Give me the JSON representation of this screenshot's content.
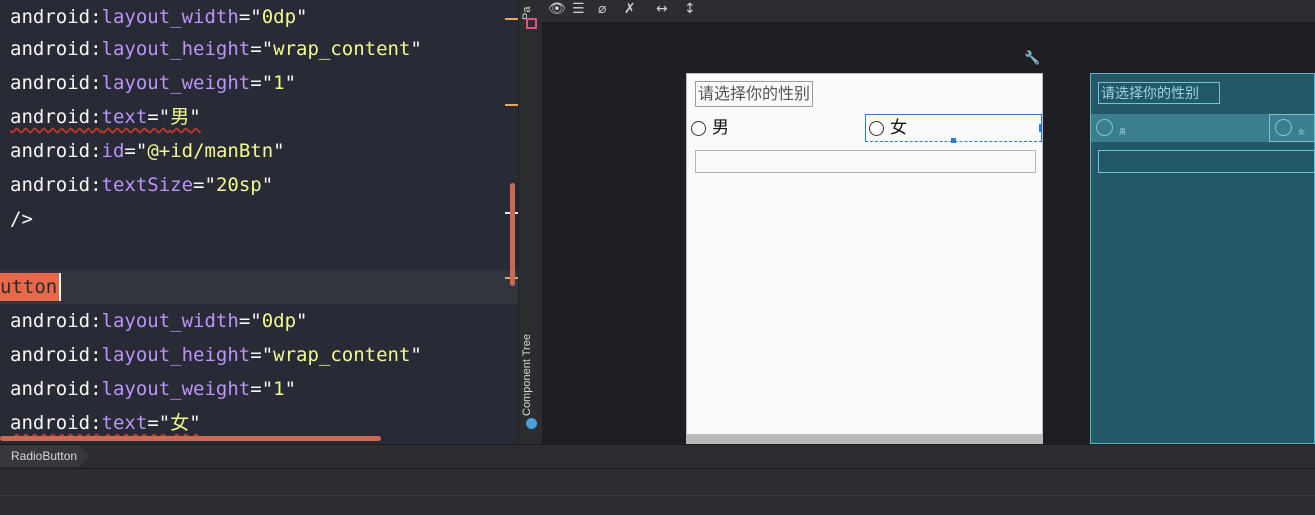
{
  "editor": {
    "lines": [
      {
        "attr": "layout_width",
        "value": "0dp"
      },
      {
        "attr": "layout_height",
        "value": "wrap_content"
      },
      {
        "attr": "layout_weight",
        "value": "1"
      },
      {
        "attr": "text",
        "value": "男"
      },
      {
        "attr": "id",
        "value": "@+id/manBtn"
      },
      {
        "attr": "textSize",
        "value": "20sp"
      }
    ],
    "close_tag": "/>",
    "selected_tag": "utton",
    "lines2": [
      {
        "attr": "layout_width",
        "value": "0dp"
      },
      {
        "attr": "layout_height",
        "value": "wrap_content"
      },
      {
        "attr": "layout_weight",
        "value": "1"
      },
      {
        "attr": "text",
        "value": "女"
      }
    ],
    "namespace": "android"
  },
  "side_panel": {
    "top_label": "Pa",
    "component_tree_label": "Component Tree"
  },
  "preview": {
    "title": "请选择你的性别",
    "radio_male": "男",
    "radio_female": "女"
  },
  "blueprint": {
    "title": "请选择你的性别",
    "radio_male": "男",
    "radio_female": "女"
  },
  "breadcrumb": {
    "item": "RadioButton"
  },
  "colors": {
    "editor_bg": "#282a36",
    "attr": "#bd93f9",
    "string": "#f1fa8c",
    "selection": "#e8694a",
    "blueprint_bg": "#235867"
  }
}
